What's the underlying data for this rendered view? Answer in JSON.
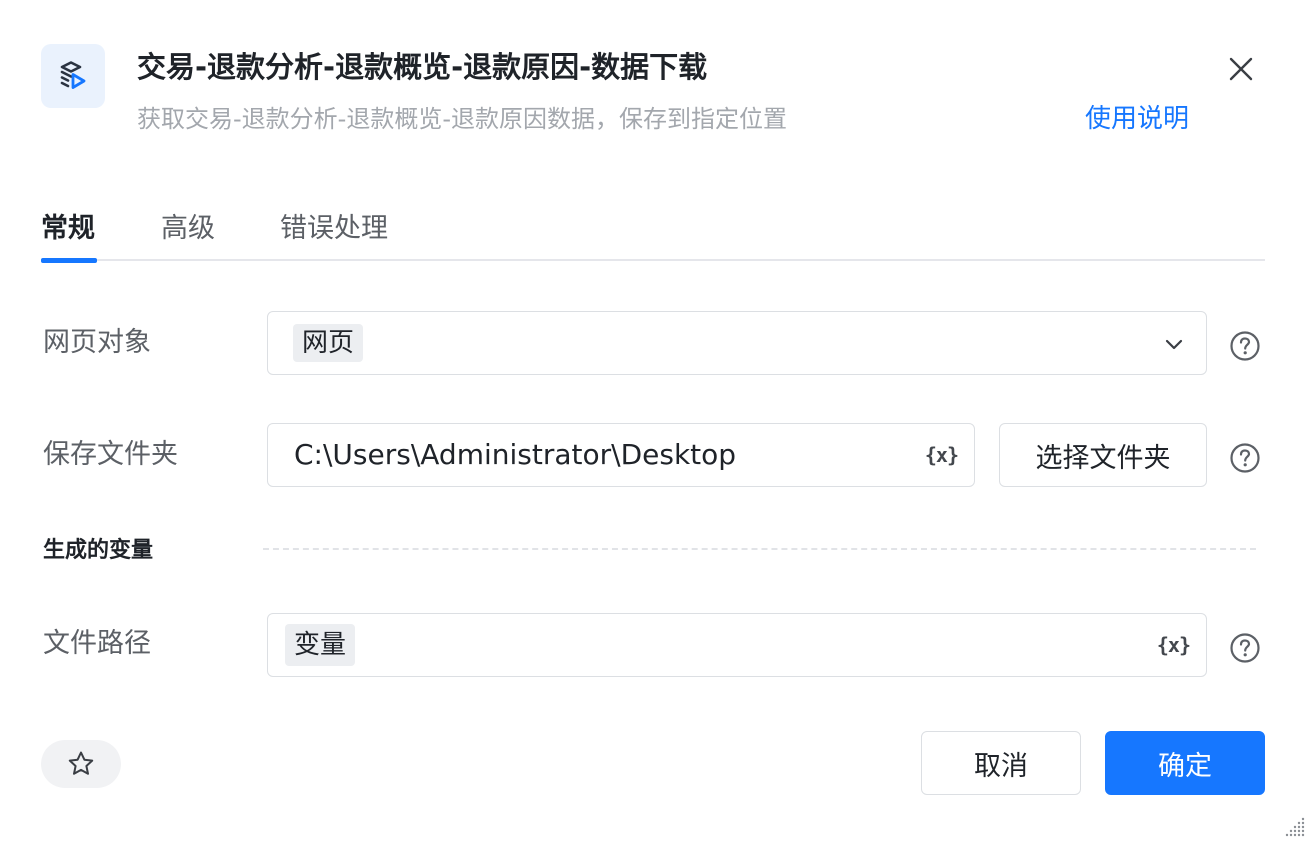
{
  "header": {
    "icon": "web-download-icon",
    "title": "交易-退款分析-退款概览-退款原因-数据下载",
    "subtitle": "获取交易-退款分析-退款概览-退款原因数据，保存到指定位置",
    "help_link": "使用说明",
    "close_icon": "close-icon"
  },
  "tabs": [
    {
      "label": "常规",
      "active": true
    },
    {
      "label": "高级",
      "active": false
    },
    {
      "label": "错误处理",
      "active": false
    }
  ],
  "form": {
    "web_object": {
      "label": "网页对象",
      "value": "网页"
    },
    "save_folder": {
      "label": "保存文件夹",
      "value": "C:\\Users\\Administrator\\Desktop",
      "variable_icon": "{x}",
      "button": "选择文件夹"
    },
    "output_section": "生成的变量",
    "file_path": {
      "label": "文件路径",
      "value": "变量",
      "variable_icon": "{x}"
    }
  },
  "footer": {
    "favorite_icon": "star-icon",
    "cancel": "取消",
    "confirm": "确定"
  },
  "colors": {
    "accent": "#1677ff",
    "icon_bg": "#eaf2fd"
  }
}
